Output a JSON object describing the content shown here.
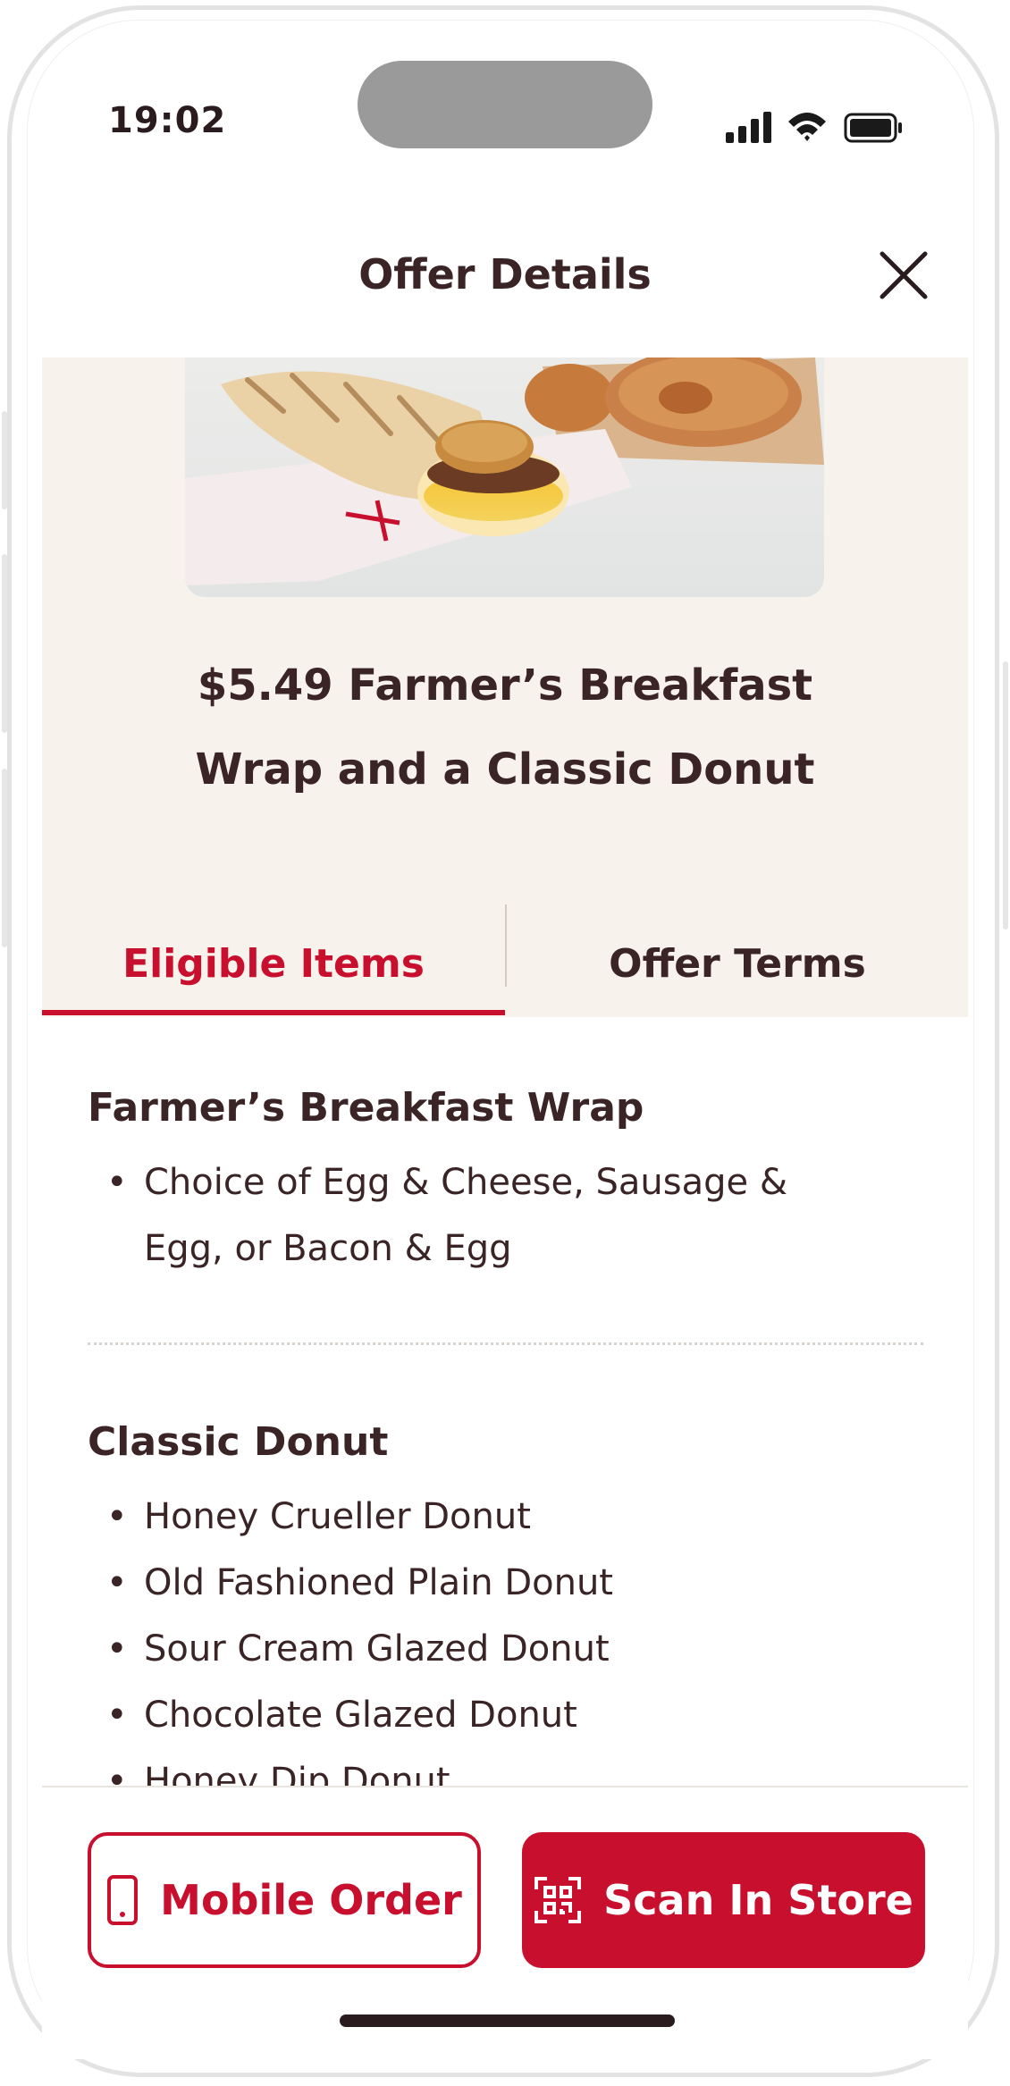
{
  "status_bar": {
    "time": "19:02"
  },
  "header": {
    "title": "Offer Details"
  },
  "offer": {
    "title_line1": "$5.49 Farmer’s Breakfast",
    "title_line2": "Wrap and a Classic Donut"
  },
  "tabs": [
    {
      "label": "Eligible Items",
      "active": true
    },
    {
      "label": "Offer Terms",
      "active": false
    }
  ],
  "eligible_items": [
    {
      "title": "Farmer’s Breakfast Wrap",
      "items": [
        "Choice of Egg & Cheese, Sausage & Egg, or Bacon & Egg"
      ]
    },
    {
      "title": "Classic Donut",
      "items": [
        "Honey Crueller Donut",
        "Old Fashioned Plain Donut",
        "Sour Cream Glazed Donut",
        "Chocolate Glazed Donut",
        "Honey Dip Donut"
      ]
    }
  ],
  "actions": {
    "mobile_order": "Mobile Order",
    "scan_in_store": "Scan In Store"
  },
  "colors": {
    "brand_red": "#c8102e",
    "text_brown": "#3a2426",
    "hero_bg": "#f7f2ec"
  }
}
